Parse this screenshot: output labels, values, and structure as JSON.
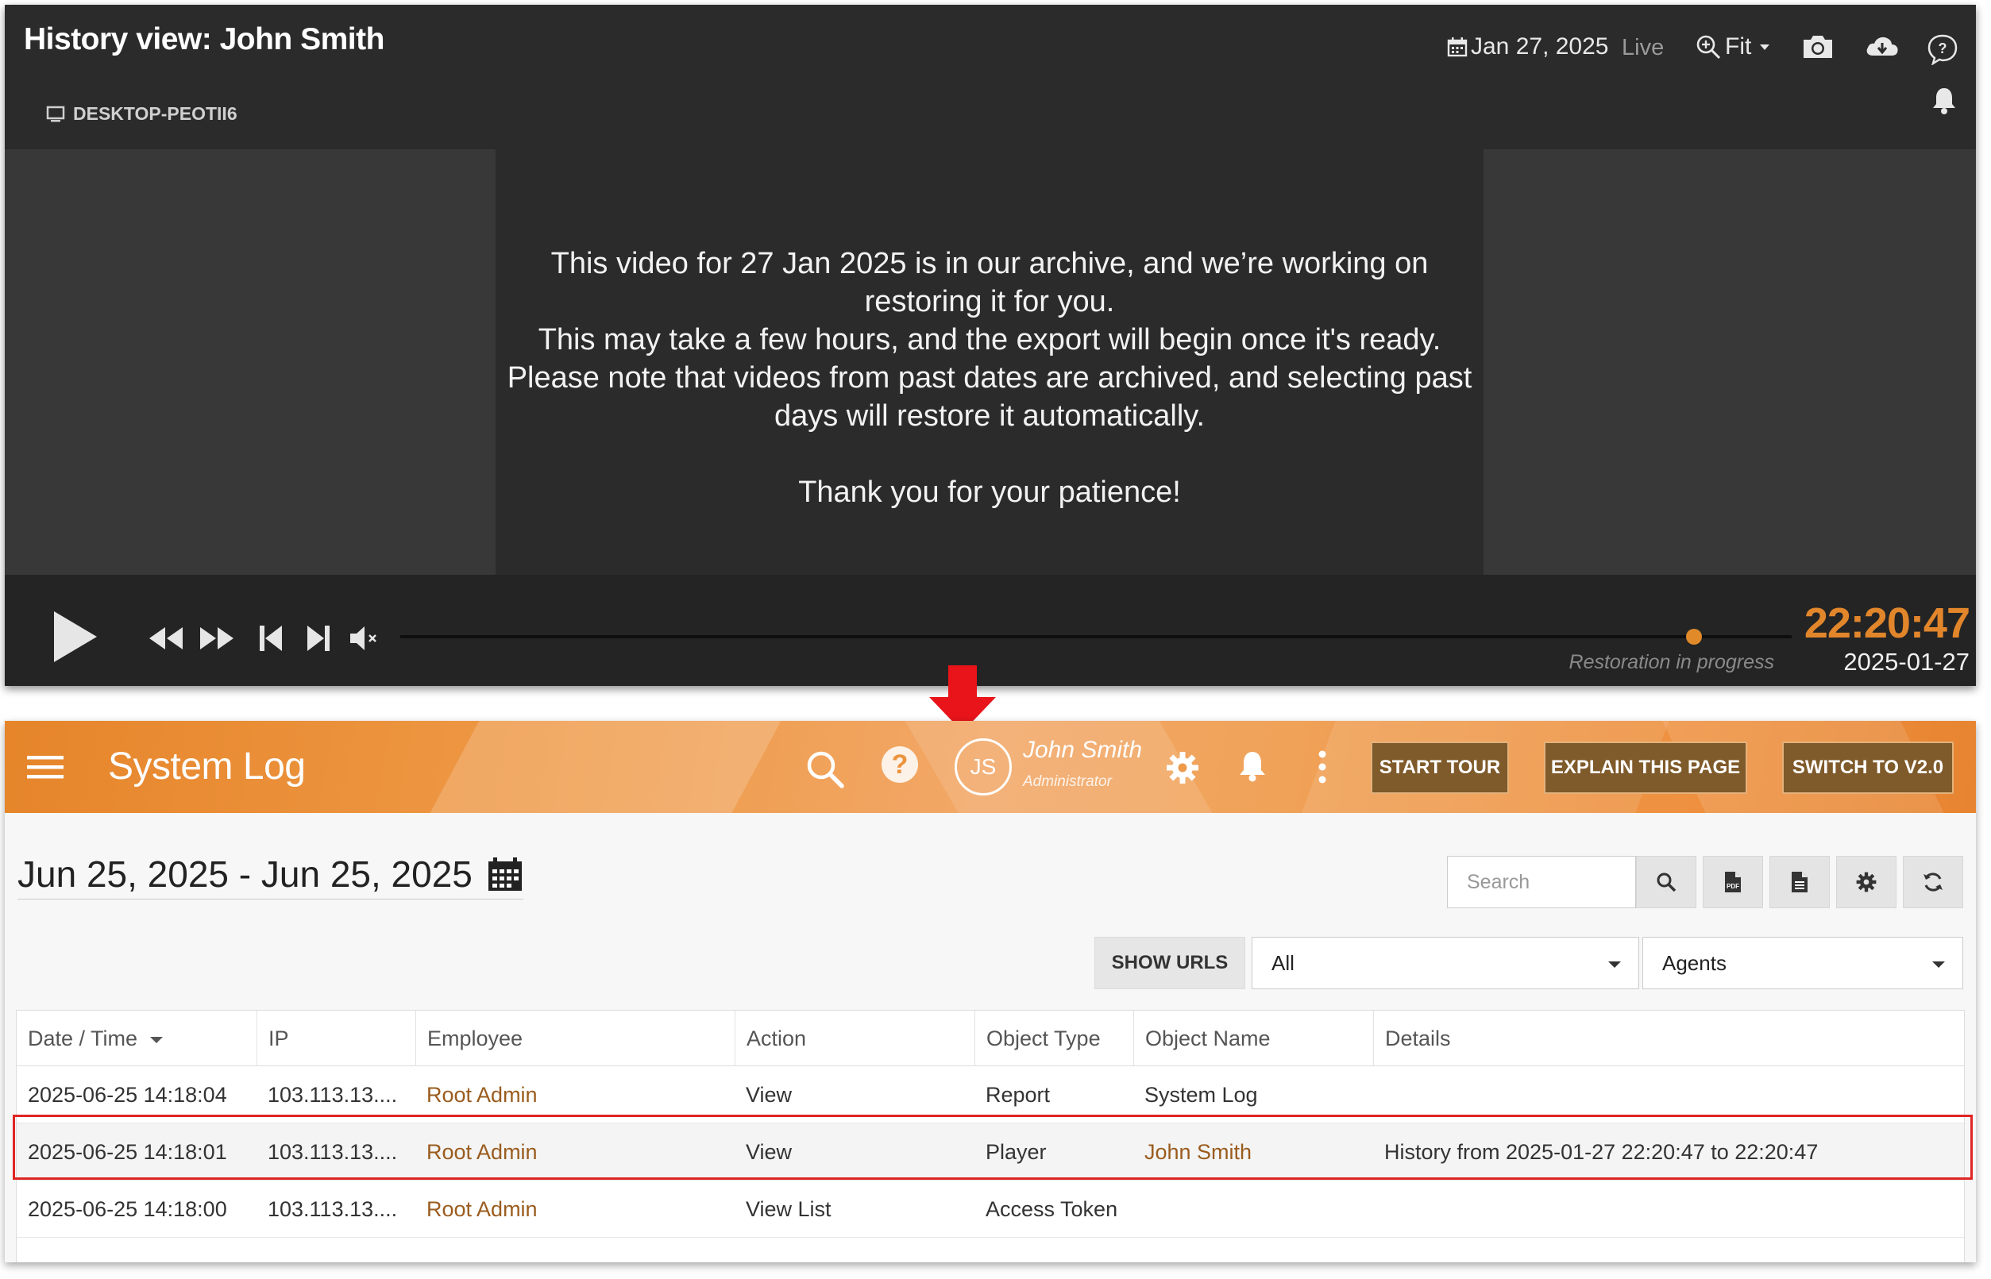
{
  "viewer": {
    "title": "History view: John Smith",
    "device": "DESKTOP-PEOTII6",
    "date": "Jan 27, 2025",
    "live_label": "Live",
    "zoom_label": "Fit",
    "message_lines": [
      "This video for 27 Jan 2025 is in our archive, and we’re working on",
      "restoring it for you.",
      "This may take a few hours, and the export will begin once it's ready.",
      "Please note that videos from past dates are archived, and selecting past",
      "days will restore it automatically."
    ],
    "message_thanks": "Thank you for your patience!",
    "status": "Restoration in progress",
    "timeline_position": 0.93,
    "clock_time": "22:20:47",
    "clock_date": "2025-01-27",
    "accent_color": "#e2862b"
  },
  "app": {
    "title": "System Log",
    "user": {
      "initials": "JS",
      "name": "John Smith",
      "role": "Administrator"
    },
    "buttons": {
      "start_tour": "START TOUR",
      "explain": "EXPLAIN THIS PAGE",
      "switch": "SWITCH TO V2.0"
    },
    "date_range": "Jun 25, 2025 - Jun 25, 2025",
    "search_placeholder": "Search",
    "show_urls": "SHOW URLS",
    "filter_all": "All",
    "filter_agents": "Agents",
    "brand_color": "#e6852a",
    "link_color": "#9a5c1e"
  },
  "table": {
    "columns": [
      "Date / Time",
      "IP",
      "Employee",
      "Action",
      "Object Type",
      "Object Name",
      "Details"
    ],
    "rows": [
      {
        "datetime": "2025-06-25 14:18:04",
        "ip": "103.113.13....",
        "employee": "Root Admin",
        "action": "View",
        "object_type": "Report",
        "object_name": "System Log",
        "details": ""
      },
      {
        "datetime": "2025-06-25 14:18:01",
        "ip": "103.113.13....",
        "employee": "Root Admin",
        "action": "View",
        "object_type": "Player",
        "object_name": "John Smith",
        "details": "History from 2025-01-27 22:20:47 to 22:20:47"
      },
      {
        "datetime": "2025-06-25 14:18:00",
        "ip": "103.113.13....",
        "employee": "Root Admin",
        "action": "View List",
        "object_type": "Access Token",
        "object_name": "",
        "details": ""
      }
    ]
  }
}
